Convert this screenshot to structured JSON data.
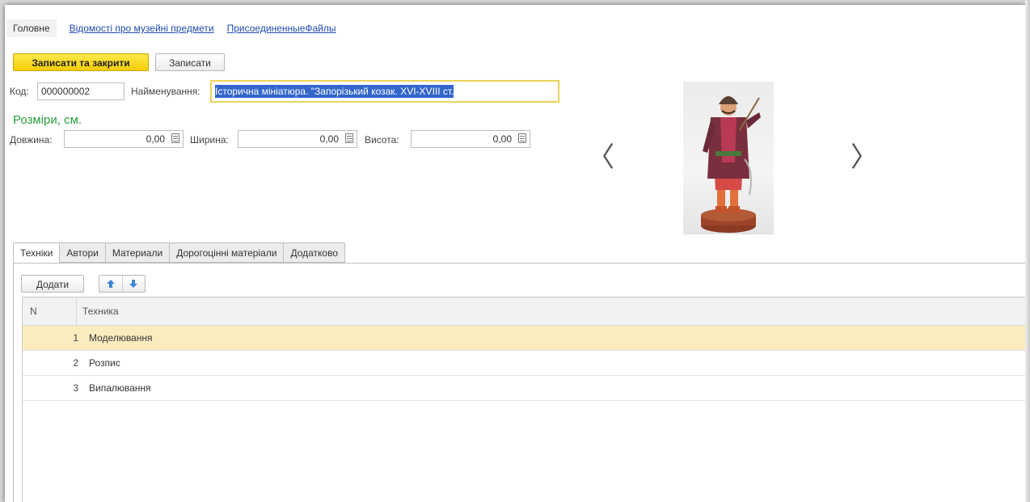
{
  "nav": {
    "main": "Головне",
    "link1": "Відомості про музейні предмети",
    "link2": "ПрисоединенныеФайлы"
  },
  "toolbar": {
    "save_close": "Записати та закрити",
    "save": "Записати"
  },
  "fields": {
    "code_label": "Код:",
    "code_value": "000000002",
    "name_label": "Найменування:",
    "name_value": "Історична мініатюра. \"Запорізький козак. XVI-XVIII ст."
  },
  "sizes": {
    "title": "Розміри, см.",
    "length_label": "Довжина:",
    "length_value": "0,00",
    "width_label": "Ширина:",
    "width_value": "0,00",
    "height_label": "Висота:",
    "height_value": "0,00"
  },
  "gallery": {
    "prev": "〈",
    "next": "〉"
  },
  "tabs": [
    "Техніки",
    "Автори",
    "Материали",
    "Дорогоцінні матеріали",
    "Додатково"
  ],
  "table": {
    "add_button": "Додати",
    "headers": {
      "n": "N",
      "technique": "Техника"
    },
    "rows": [
      {
        "n": "1",
        "technique": "Моделювання"
      },
      {
        "n": "2",
        "technique": "Розпис"
      },
      {
        "n": "3",
        "technique": "Випалювання"
      }
    ]
  },
  "colors": {
    "primary_button": "#f6cd05",
    "section_title": "#2a9d3a",
    "link": "#1f4bb0",
    "selected_row": "#fbecbe",
    "selection": "#3366cc"
  }
}
